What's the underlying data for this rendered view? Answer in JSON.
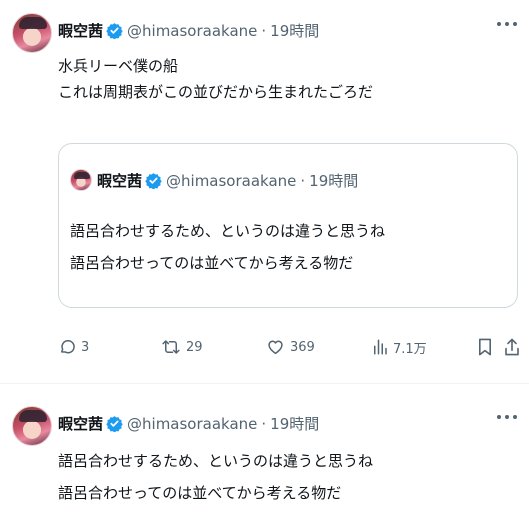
{
  "tweets": [
    {
      "author": {
        "name": "暇空茜",
        "handle": "@himasoraakane",
        "time": "19時間"
      },
      "text_lines": [
        "水兵リーベ僕の船",
        "これは周期表がこの並びだから生まれたごろだ"
      ],
      "quote": {
        "author": {
          "name": "暇空茜",
          "handle": "@himasoraakane",
          "time": "19時間"
        },
        "text_lines": [
          "語呂合わせするため、というのは違うと思うね",
          "語呂合わせってのは並べてから考える物だ"
        ]
      },
      "actions": {
        "replies": "3",
        "retweets": "29",
        "likes": "369",
        "views": "7.1万"
      }
    },
    {
      "author": {
        "name": "暇空茜",
        "handle": "@himasoraakane",
        "time": "19時間"
      },
      "text_lines": [
        "語呂合わせするため、というのは違うと思うね",
        "語呂合わせってのは並べてから考える物だ"
      ]
    }
  ],
  "colors": {
    "text": "#0f1419",
    "secondary": "#536471",
    "verified": "#1d9bf0",
    "border": "#cfd9de"
  },
  "icons": [
    "more-icon",
    "verified-icon",
    "reply-icon",
    "retweet-icon",
    "like-icon",
    "views-icon",
    "bookmark-icon",
    "share-icon"
  ]
}
